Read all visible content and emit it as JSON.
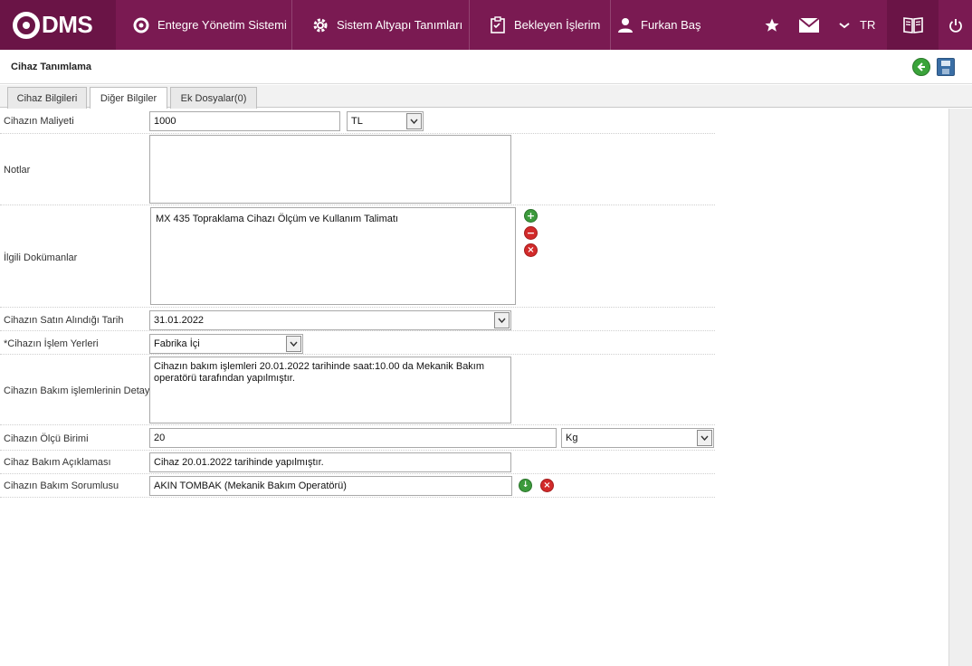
{
  "app": {
    "logo_text": "DMS",
    "nav": {
      "integrated_system": "Entegre Yönetim Sistemi",
      "infrastructure": "Sistem Altyapı Tanımları",
      "pending": "Bekleyen İşlerim",
      "user": "Furkan Baş",
      "language": "TR"
    }
  },
  "page": {
    "title": "Cihaz Tanımlama"
  },
  "tabs": [
    {
      "label": "Cihaz Bilgileri"
    },
    {
      "label": "Diğer Bilgiler"
    },
    {
      "label": "Ek Dosyalar(0)"
    }
  ],
  "form": {
    "cost": {
      "label": "Cihazın Maliyeti",
      "value": "1000",
      "currency": "TL"
    },
    "notes": {
      "label": "Notlar",
      "value": ""
    },
    "documents": {
      "label": "İlgili Dokümanlar",
      "value": "MX 435 Topraklama Cihazı Ölçüm ve Kullanım Talimatı"
    },
    "purchase_date": {
      "label": "Cihazın Satın Alındığı Tarih",
      "value": "31.01.2022"
    },
    "locations": {
      "label": "*Cihazın İşlem Yerleri",
      "value": "Fabrika İçi"
    },
    "maintenance_detail": {
      "label": "Cihazın Bakım işlemlerinin Detayı",
      "value": "Cihazın bakım işlemleri 20.01.2022 tarihinde saat:10.00 da Mekanik Bakım operatörü tarafından yapılmıştır."
    },
    "measure_unit": {
      "label": "Cihazın Ölçü Birimi",
      "value": "20",
      "unit": "Kg"
    },
    "maintenance_desc": {
      "label": "Cihaz Bakım Açıklaması",
      "value": "Cihaz 20.01.2022 tarihinde yapılmıştır."
    },
    "maintenance_owner": {
      "label": "Cihazın Bakım Sorumlusu",
      "value": "AKIN TOMBAK (Mekanik Bakım Operatörü)"
    }
  },
  "colors": {
    "topbar": "#7a1a52",
    "accent_green": "#3c9a3c",
    "accent_red": "#d22a2a"
  }
}
